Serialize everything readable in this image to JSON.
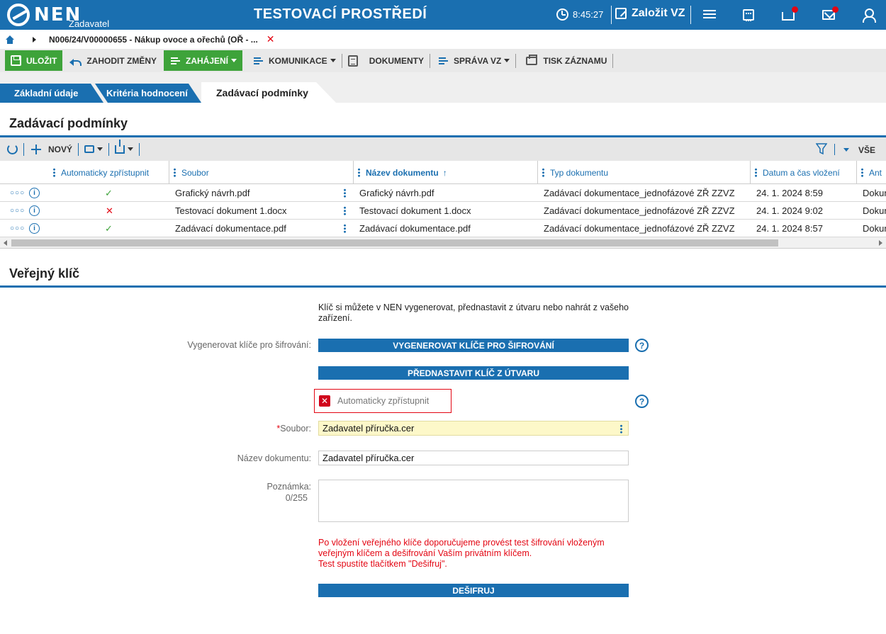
{
  "header": {
    "logo_text": "NEN",
    "logo_sub": "Zadavatel",
    "env_title": "TESTOVACÍ PROSTŘEDÍ",
    "time": "8:45:27",
    "create_label": "Založit VZ"
  },
  "breadcrumb": {
    "path": "N006/24/V00000655 - Nákup ovoce a ořechů (OŘ - ..."
  },
  "toolbar": {
    "save": "ULOŽIT",
    "discard": "ZAHODIT ZMĚNY",
    "start": "ZAHÁJENÍ",
    "communication": "KOMUNIKACE",
    "documents": "DOKUMENTY",
    "management": "SPRÁVA VZ",
    "print": "TISK ZÁZNAMU"
  },
  "tabs": [
    {
      "label": "Základní údaje"
    },
    {
      "label": "Kritéria hodnocení"
    },
    {
      "label": "Zadávací podmínky"
    }
  ],
  "section1": {
    "title": "Zadávací podmínky",
    "new_label": "NOVÝ",
    "all_label": "VŠE",
    "columns": [
      "Automaticky zpřístupnit",
      "Soubor",
      "Název dokumentu",
      "Typ dokumentu",
      "Datum a čas vložení",
      "Ant"
    ],
    "rows": [
      {
        "auto": true,
        "file": "Grafický návrh.pdf",
        "name": "Grafický návrh.pdf",
        "type": "Zadávací dokumentace_jednofázové ZŘ ZZVZ",
        "date": "24. 1. 2024 8:59",
        "ant": "Dokum"
      },
      {
        "auto": false,
        "file": "Testovací dokument 1.docx",
        "name": "Testovací dokument 1.docx",
        "type": "Zadávací dokumentace_jednofázové ZŘ ZZVZ",
        "date": "24. 1. 2024 9:02",
        "ant": "Dokum"
      },
      {
        "auto": true,
        "file": "Zadávací dokumentace.pdf",
        "name": "Zadávací dokumentace.pdf",
        "type": "Zadávací dokumentace_jednofázové ZŘ ZZVZ",
        "date": "24. 1. 2024 8:57",
        "ant": "Dokum"
      }
    ]
  },
  "section2": {
    "title": "Veřejný klíč",
    "hint": "Klíč si můžete v NEN vygenerovat, přednastavit z útvaru nebo nahrát z vašeho zařízení.",
    "generate_label": "Vygenerovat klíče pro šifrování:",
    "generate_button": "VYGENEROVAT KLÍČE PRO ŠIFROVÁNÍ",
    "preset_button": "PŘEDNASTAVIT KLÍČ Z ÚTVARU",
    "auto_checkbox": "Automaticky zpřístupnit",
    "file_label": "Soubor:",
    "file_value": "Zadavatel příručka.cer",
    "docname_label": "Název dokumentu:",
    "docname_value": "Zadavatel příručka.cer",
    "note_label": "Poznámka:",
    "note_count": "0/255",
    "warning_line1": "Po vložení veřejného klíče doporučujeme provést test šifrování vloženým veřejným klíčem a dešifrování Vaším privátním klíčem.",
    "warning_line2": "Test spustíte tlačítkem \"Dešifruj\".",
    "decrypt_button": "DEŠIFRUJ"
  }
}
